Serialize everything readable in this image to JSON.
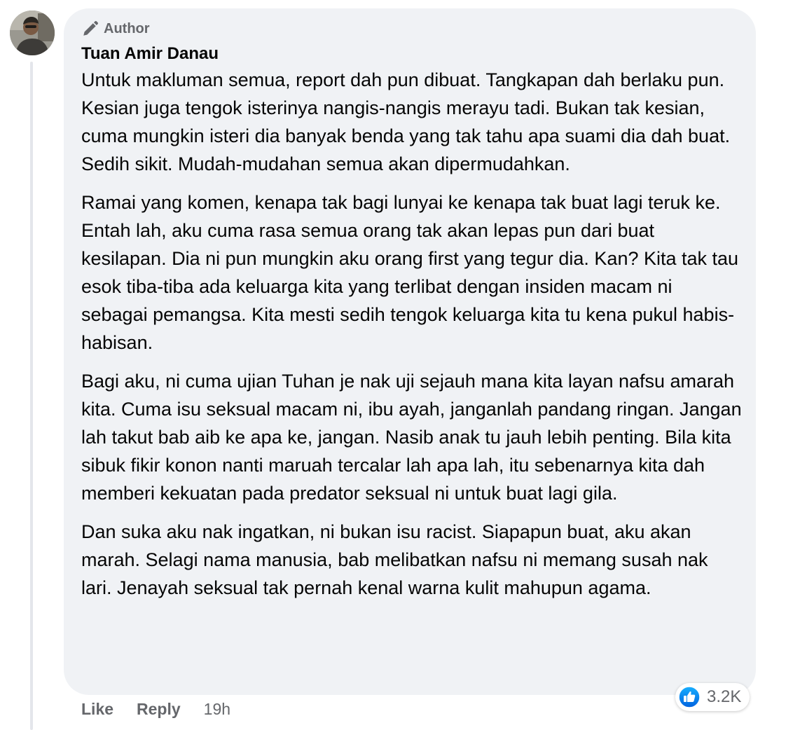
{
  "comment": {
    "badge_label": "Author",
    "badge_icon": "pencil-icon",
    "author_name": "Tuan Amir Danau",
    "paragraphs": [
      "Untuk makluman semua, report dah pun dibuat. Tangkapan dah berlaku pun. Kesian juga tengok isterinya nangis-nangis merayu tadi. Bukan tak kesian, cuma mungkin isteri dia banyak benda yang tak tahu apa suami dia dah buat. Sedih sikit. Mudah-mudahan semua akan dipermudahkan.",
      "Ramai yang komen, kenapa tak bagi lunyai ke kenapa tak buat lagi teruk ke. Entah lah, aku cuma rasa semua orang tak akan lepas pun dari buat kesilapan. Dia ni pun mungkin aku orang first yang tegur dia. Kan? Kita tak tau esok tiba-tiba ada keluarga kita yang terlibat dengan insiden macam ni sebagai pemangsa. Kita mesti sedih tengok keluarga kita tu kena pukul habis-habisan.",
      "Bagi aku, ni cuma ujian Tuhan je nak uji sejauh mana kita layan nafsu amarah kita. Cuma isu seksual macam ni, ibu ayah, janganlah pandang ringan. Jangan lah takut bab aib ke apa ke, jangan. Nasib anak tu jauh lebih penting. Bila kita sibuk fikir konon nanti maruah tercalar lah apa lah, itu sebenarnya kita dah memberi kekuatan pada predator seksual ni untuk buat lagi gila.",
      "Dan suka aku nak ingatkan, ni bukan isu racist. Siapapun buat, aku akan marah. Selagi nama manusia, bab melibatkan nafsu ni memang susah nak lari. Jenayah seksual tak pernah kenal warna kulit mahupun agama."
    ]
  },
  "actions": {
    "like_label": "Like",
    "reply_label": "Reply",
    "timestamp": "19h"
  },
  "reactions": {
    "icon": "like-reaction-icon",
    "count": "3.2K"
  },
  "colors": {
    "bubble_bg": "#f0f2f5",
    "secondary_text": "#65676b",
    "like_blue": "#1877f2"
  }
}
